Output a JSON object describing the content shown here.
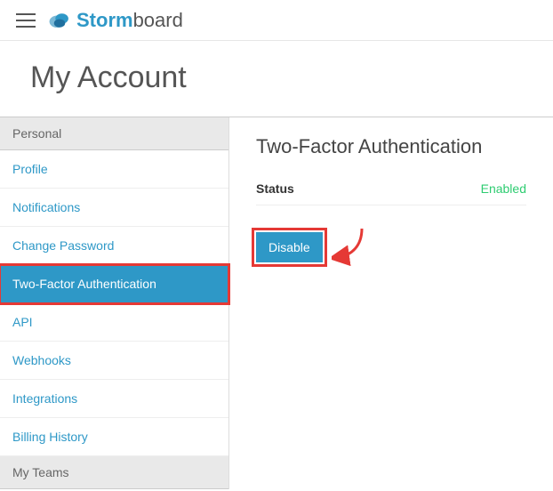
{
  "brand": {
    "first": "Storm",
    "second": "board"
  },
  "page_title": "My Account",
  "sidebar": {
    "sections": [
      {
        "label": "Personal",
        "items": [
          {
            "label": "Profile",
            "active": false
          },
          {
            "label": "Notifications",
            "active": false
          },
          {
            "label": "Change Password",
            "active": false
          },
          {
            "label": "Two-Factor Authentication",
            "active": true
          },
          {
            "label": "API",
            "active": false
          },
          {
            "label": "Webhooks",
            "active": false
          },
          {
            "label": "Integrations",
            "active": false
          },
          {
            "label": "Billing History",
            "active": false
          }
        ]
      },
      {
        "label": "My Teams",
        "items": []
      }
    ]
  },
  "main": {
    "heading": "Two-Factor Authentication",
    "status_label": "Status",
    "status_value": "Enabled",
    "disable_label": "Disable"
  },
  "annotations": {
    "highlight_color": "#e53935"
  }
}
